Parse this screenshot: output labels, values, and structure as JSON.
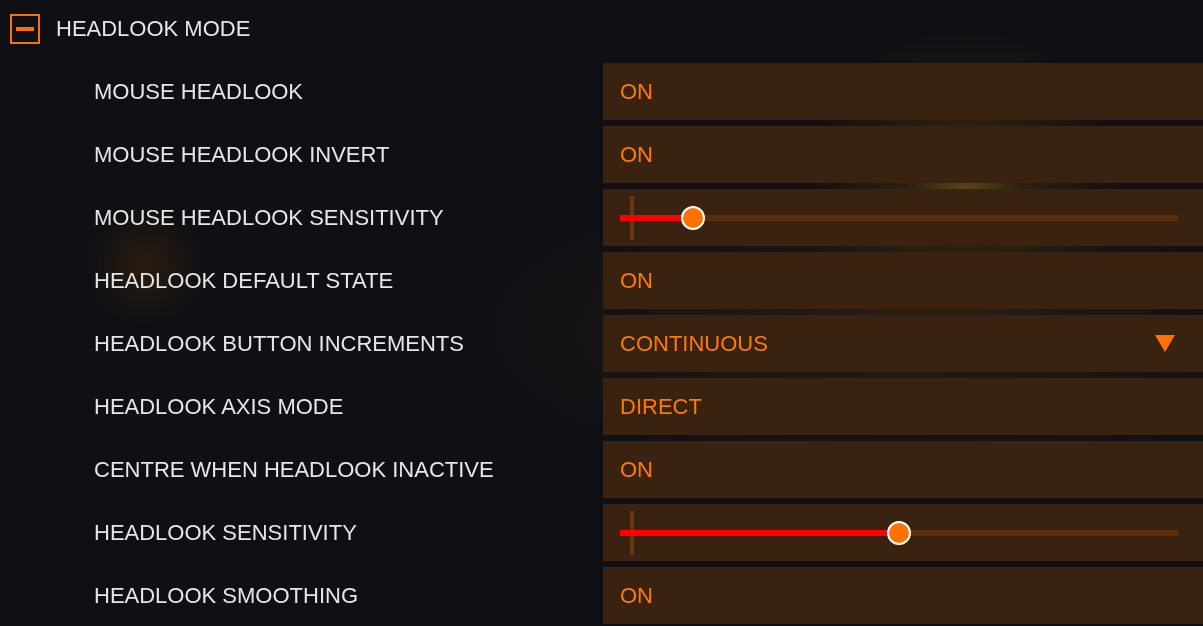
{
  "section": {
    "title": "HEADLOOK MODE",
    "expanded": true
  },
  "settings": [
    {
      "kind": "value",
      "label": "MOUSE HEADLOOK",
      "value": "ON"
    },
    {
      "kind": "value",
      "label": "MOUSE HEADLOOK INVERT",
      "value": "ON"
    },
    {
      "kind": "slider",
      "label": "MOUSE HEADLOOK SENSITIVITY",
      "level": 0.13
    },
    {
      "kind": "value",
      "label": "HEADLOOK DEFAULT STATE",
      "value": "ON"
    },
    {
      "kind": "dropdown",
      "label": "HEADLOOK BUTTON INCREMENTS",
      "value": "CONTINUOUS"
    },
    {
      "kind": "value",
      "label": "HEADLOOK AXIS MODE",
      "value": "DIRECT"
    },
    {
      "kind": "value",
      "label": "CENTRE WHEN HEADLOOK INACTIVE",
      "value": "ON"
    },
    {
      "kind": "slider",
      "label": "HEADLOOK SENSITIVITY",
      "level": 0.5
    },
    {
      "kind": "value",
      "label": "HEADLOOK SMOOTHING",
      "value": "ON"
    }
  ]
}
